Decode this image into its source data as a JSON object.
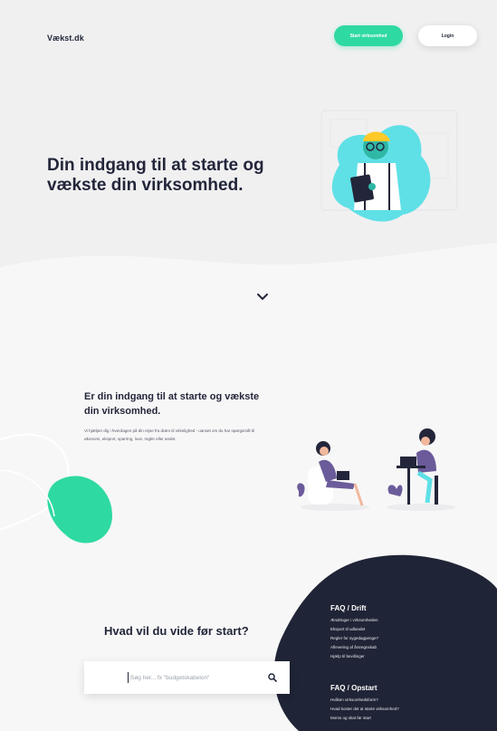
{
  "header": {
    "logo": "Vækst.dk",
    "start_button": "Start virksomhed",
    "login_button": "Login"
  },
  "hero": {
    "title": "Din indgang til at starte og vækste din virksomhed."
  },
  "intro": {
    "title": "Er din indgang til at starte og vækste din virksomhed.",
    "text": "Vi hjælper dig i hverdagen på din rejse fra drøm til virkelighed - uanset om du har spørgsmål til økonomi, eksport, sparring, love, regler eller andet."
  },
  "search": {
    "question": "Hvad vil du vide før start?",
    "placeholder": "Søg her... fx \"budgetskabelon\""
  },
  "faq_drift": {
    "title": "FAQ / Drift",
    "items": [
      "Ændringer i virksomheden",
      "Eksport til udlandet",
      "Regler for sygedagpenge?",
      "Aflevering af årsregnskab",
      "Hjælp til bevillinger"
    ]
  },
  "faq_opstart": {
    "title": "FAQ / Opstart",
    "items": [
      "Hvilken virksomhedsform?",
      "Hvad koster det at starte virksomhed?",
      "Moms og skat før start"
    ]
  },
  "colors": {
    "accent": "#2fd9a2",
    "dark": "#1f2436",
    "illustration_teal": "#5fe0e6"
  }
}
